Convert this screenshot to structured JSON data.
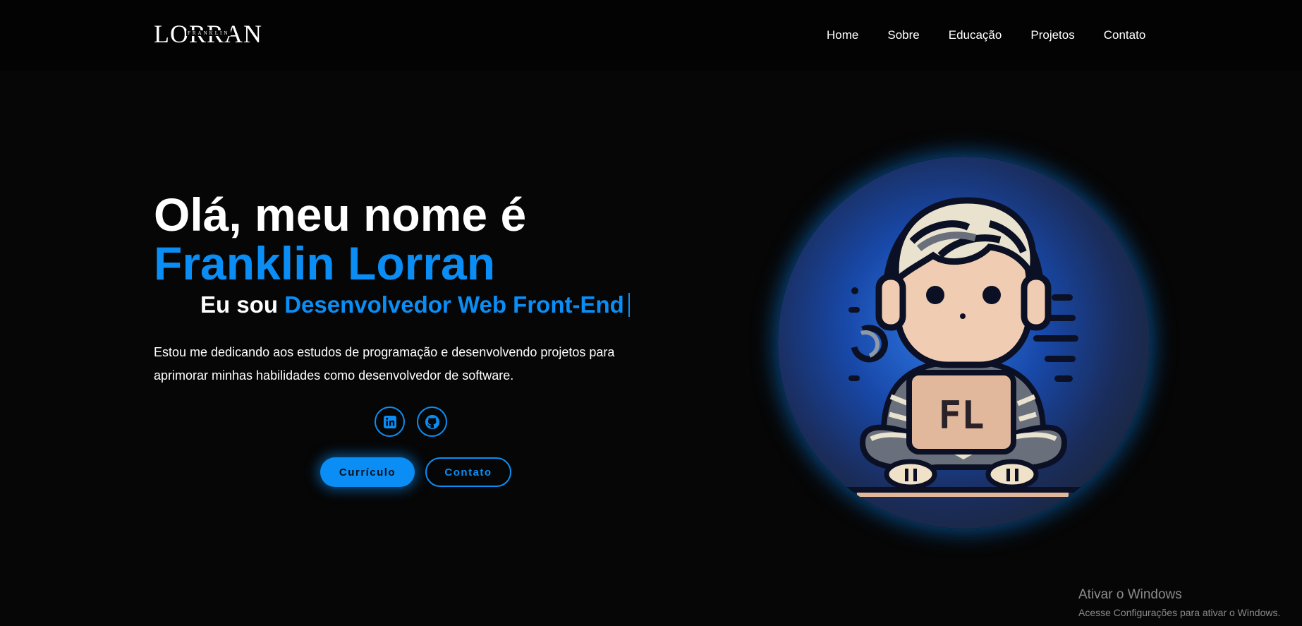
{
  "header": {
    "logo_main": "LORRAN",
    "logo_sub": "FRANKLIN",
    "nav": [
      {
        "label": "Home"
      },
      {
        "label": "Sobre"
      },
      {
        "label": "Educação"
      },
      {
        "label": "Projetos"
      },
      {
        "label": "Contato"
      }
    ]
  },
  "hero": {
    "greeting": "Olá, meu nome é",
    "name": "Franklin Lorran",
    "role_prefix": "Eu sou",
    "role_text": "Desenvolvedor Web Front-End",
    "description": "Estou me dedicando aos estudos de programação e desenvolvendo projetos para aprimorar minhas habilidades como desenvolvedor de software."
  },
  "social": [
    {
      "icon": "linkedin-icon"
    },
    {
      "icon": "github-icon"
    }
  ],
  "buttons": {
    "primary_label": "Currículo",
    "secondary_label": "Contato"
  },
  "avatar": {
    "laptop_logo": "FL"
  },
  "watermark": {
    "title": "Ativar o Windows",
    "subtitle": "Acesse Configurações para ativar o Windows."
  },
  "colors": {
    "accent": "#0a8ef5",
    "background": "#060606",
    "header_bg": "#030303"
  }
}
